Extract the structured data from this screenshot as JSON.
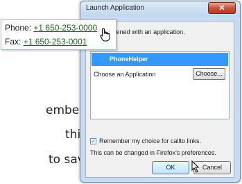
{
  "background_text": {
    "line1": "ember",
    "line2": "this is",
    "line3": "to save"
  },
  "dialog": {
    "title": "Launch Application",
    "close_icon": "close-icon",
    "intro": "s to be opened with an application.",
    "selected_app": "PhoneHelper",
    "choose_label": "Choose an Application",
    "choose_button": "Choose...",
    "remember_label": "Remember my choice for callto links.",
    "remember_checked": true,
    "note": "This can be changed in Firefox's preferences.",
    "ok_button": "OK",
    "cancel_button": "Cancel"
  },
  "contact": {
    "phone_label": "Phone:",
    "phone_number": "+1 650-253-0000",
    "fax_label": "Fax:",
    "fax_number": "+1 650-253-0001"
  },
  "colors": {
    "link": "#1a6b1a",
    "selection": "#3399ff",
    "tooltip_border": "#e6b25a"
  }
}
